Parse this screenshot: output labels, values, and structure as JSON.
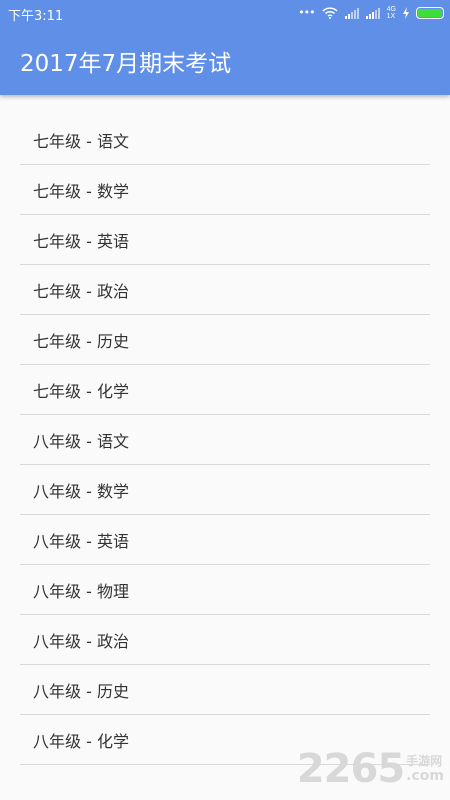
{
  "status_bar": {
    "time": "下午3:11",
    "network_top": "4G",
    "network_bottom": "1X",
    "icons": [
      "more-dots-icon",
      "wifi-icon",
      "signal-icon",
      "signal-icon",
      "charging-icon",
      "battery-icon"
    ],
    "battery_color": "#3dde3a"
  },
  "header": {
    "title": "2017年7月期末考试",
    "background": "#5f8fe7"
  },
  "list": {
    "items": [
      "七年级 - 语文",
      "七年级 - 数学",
      "七年级 - 英语",
      "七年级 - 政治",
      "七年级 - 历史",
      "七年级 - 化学",
      "八年级 - 语文",
      "八年级 - 数学",
      "八年级 - 英语",
      "八年级 - 物理",
      "八年级 - 政治",
      "八年级 - 历史",
      "八年级 - 化学"
    ]
  },
  "watermark": {
    "digits": "2265",
    "cn_text": "手游网",
    "suffix": ".com"
  }
}
